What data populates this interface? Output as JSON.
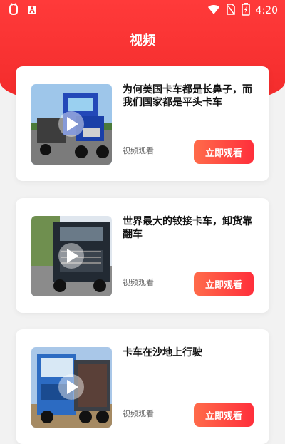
{
  "status": {
    "time": "4:20",
    "left_icons": [
      "bug-icon",
      "a-box-icon"
    ],
    "right_icons": [
      "wifi-icon",
      "sim-icon",
      "battery-icon"
    ]
  },
  "header": {
    "title": "视频"
  },
  "cards": [
    {
      "title": "为何美国卡车都是长鼻子，而我们国家都是平头卡车",
      "sub": "视频观看",
      "button": "立即观看"
    },
    {
      "title": "世界最大的铰接卡车，卸货靠翻车",
      "sub": "视频观看",
      "button": "立即观看"
    },
    {
      "title": "卡车在沙地上行驶",
      "sub": "视频观看",
      "button": "立即观看"
    }
  ],
  "colors": {
    "header_red": "#f22a2a",
    "button_start": "#ff6b4a",
    "button_end": "#ff2f3b",
    "page_bg": "#f2f2f2"
  }
}
